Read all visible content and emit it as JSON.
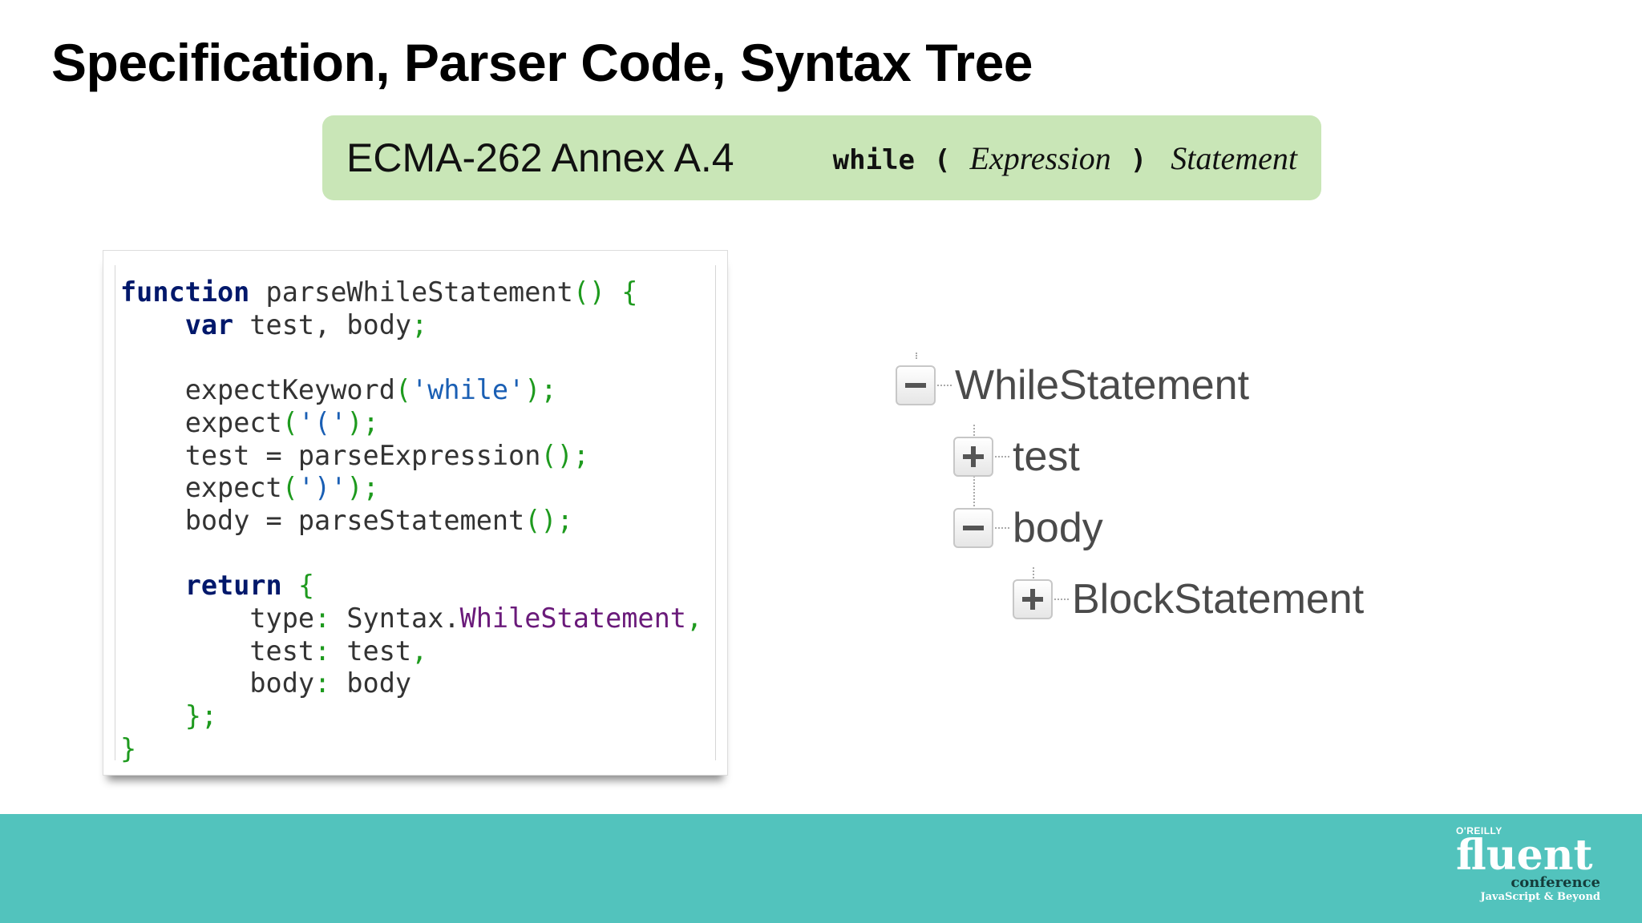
{
  "slide": {
    "title": "Specification, Parser Code, Syntax Tree"
  },
  "spec": {
    "label": "ECMA-262 Annex A.4",
    "keyword": "while",
    "open_paren": "(",
    "expression": "Expression",
    "close_paren": ")",
    "statement": "Statement"
  },
  "code": {
    "function_kw": "function",
    "function_name": " parseWhileStatement",
    "var_kw": "var",
    "var_names": " test, body",
    "expect_keyword_call": "expectKeyword",
    "while_string": "'while'",
    "expect_call": "expect",
    "open_paren_string": "'('",
    "test_assign": "test = parseExpression",
    "close_paren_string": "')'",
    "body_assign": "body = parseStatement",
    "return_kw": "return",
    "type_key": "type",
    "syntax_ref": " Syntax.",
    "while_statement_prop": "WhileStatement",
    "test_key": "test",
    "test_value": " test",
    "body_key": "body",
    "body_value": " body"
  },
  "tree": {
    "root": "WhileStatement",
    "test": "test",
    "body": "body",
    "block": "BlockStatement"
  },
  "footer": {
    "logo_small": "O'REILLY",
    "logo_main": "fluent",
    "logo_conference": "conference",
    "logo_tagline": "JavaScript & Beyond"
  },
  "colors": {
    "spec_box": "#c9e6b7",
    "footer_bar": "#52c3bd",
    "code_keyword": "#00186b",
    "code_punctuation": "#1e9a1e",
    "code_string": "#1a5fb4",
    "code_member": "#6a1a7a"
  }
}
